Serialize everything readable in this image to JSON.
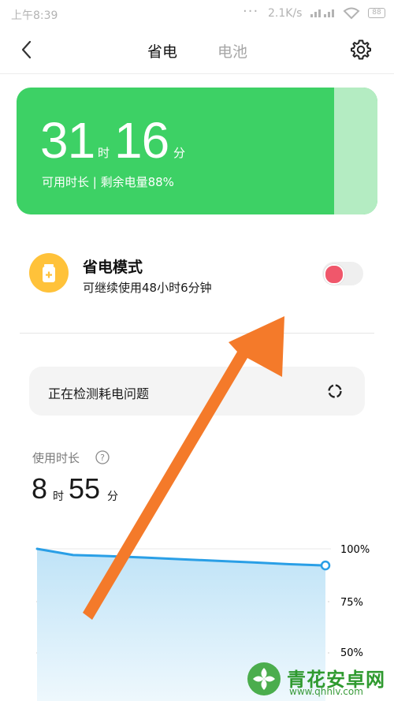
{
  "status_bar": {
    "time": "上午8:39",
    "dots": "···",
    "speed": "2.1K/s",
    "battery": "88"
  },
  "header": {
    "tab_active": "省电",
    "tab_inactive": "电池"
  },
  "battery_card": {
    "hours": "31",
    "hours_unit": "时",
    "minutes": "16",
    "minutes_unit": "分",
    "subtitle": "可用时长 | 剩余电量88%",
    "color": "#3dd165"
  },
  "power_save": {
    "title": "省电模式",
    "subtitle": "可继续使用48小时6分钟",
    "toggle_on": false,
    "icon_color": "#ffc23a"
  },
  "detect": {
    "label": "正在检测耗电问题"
  },
  "usage": {
    "label": "使用时长",
    "hours": "8",
    "hours_unit": "时",
    "minutes": "55",
    "minutes_unit": "分"
  },
  "chart_data": {
    "type": "area",
    "y_ticks": [
      "100%",
      "75%",
      "50%"
    ],
    "ylim": [
      50,
      100
    ],
    "values": [
      100,
      97,
      96.5,
      95.8,
      95,
      94.2,
      93.5,
      92.6,
      92
    ],
    "line_color": "#2a9fe6",
    "grid": true
  },
  "watermark": {
    "name": "青花安卓网",
    "url": "www.qhhlv.com"
  },
  "annotation": {
    "arrow_color": "#f47a2a"
  }
}
